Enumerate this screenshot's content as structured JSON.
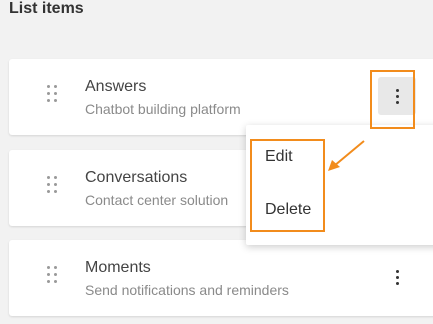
{
  "page": {
    "title": "List items"
  },
  "items": [
    {
      "title": "Answers",
      "subtitle": "Chatbot building platform"
    },
    {
      "title": "Conversations",
      "subtitle": "Contact center solution"
    },
    {
      "title": "Moments",
      "subtitle": "Send notifications and reminders"
    }
  ],
  "menu": {
    "edit_label": "Edit",
    "delete_label": "Delete"
  },
  "colors": {
    "highlight": "#f28c1c",
    "background": "#f2f2f2",
    "card": "#ffffff"
  },
  "icons": {
    "drag_handle": "drag-handle-icon",
    "more": "more-vertical-icon"
  }
}
